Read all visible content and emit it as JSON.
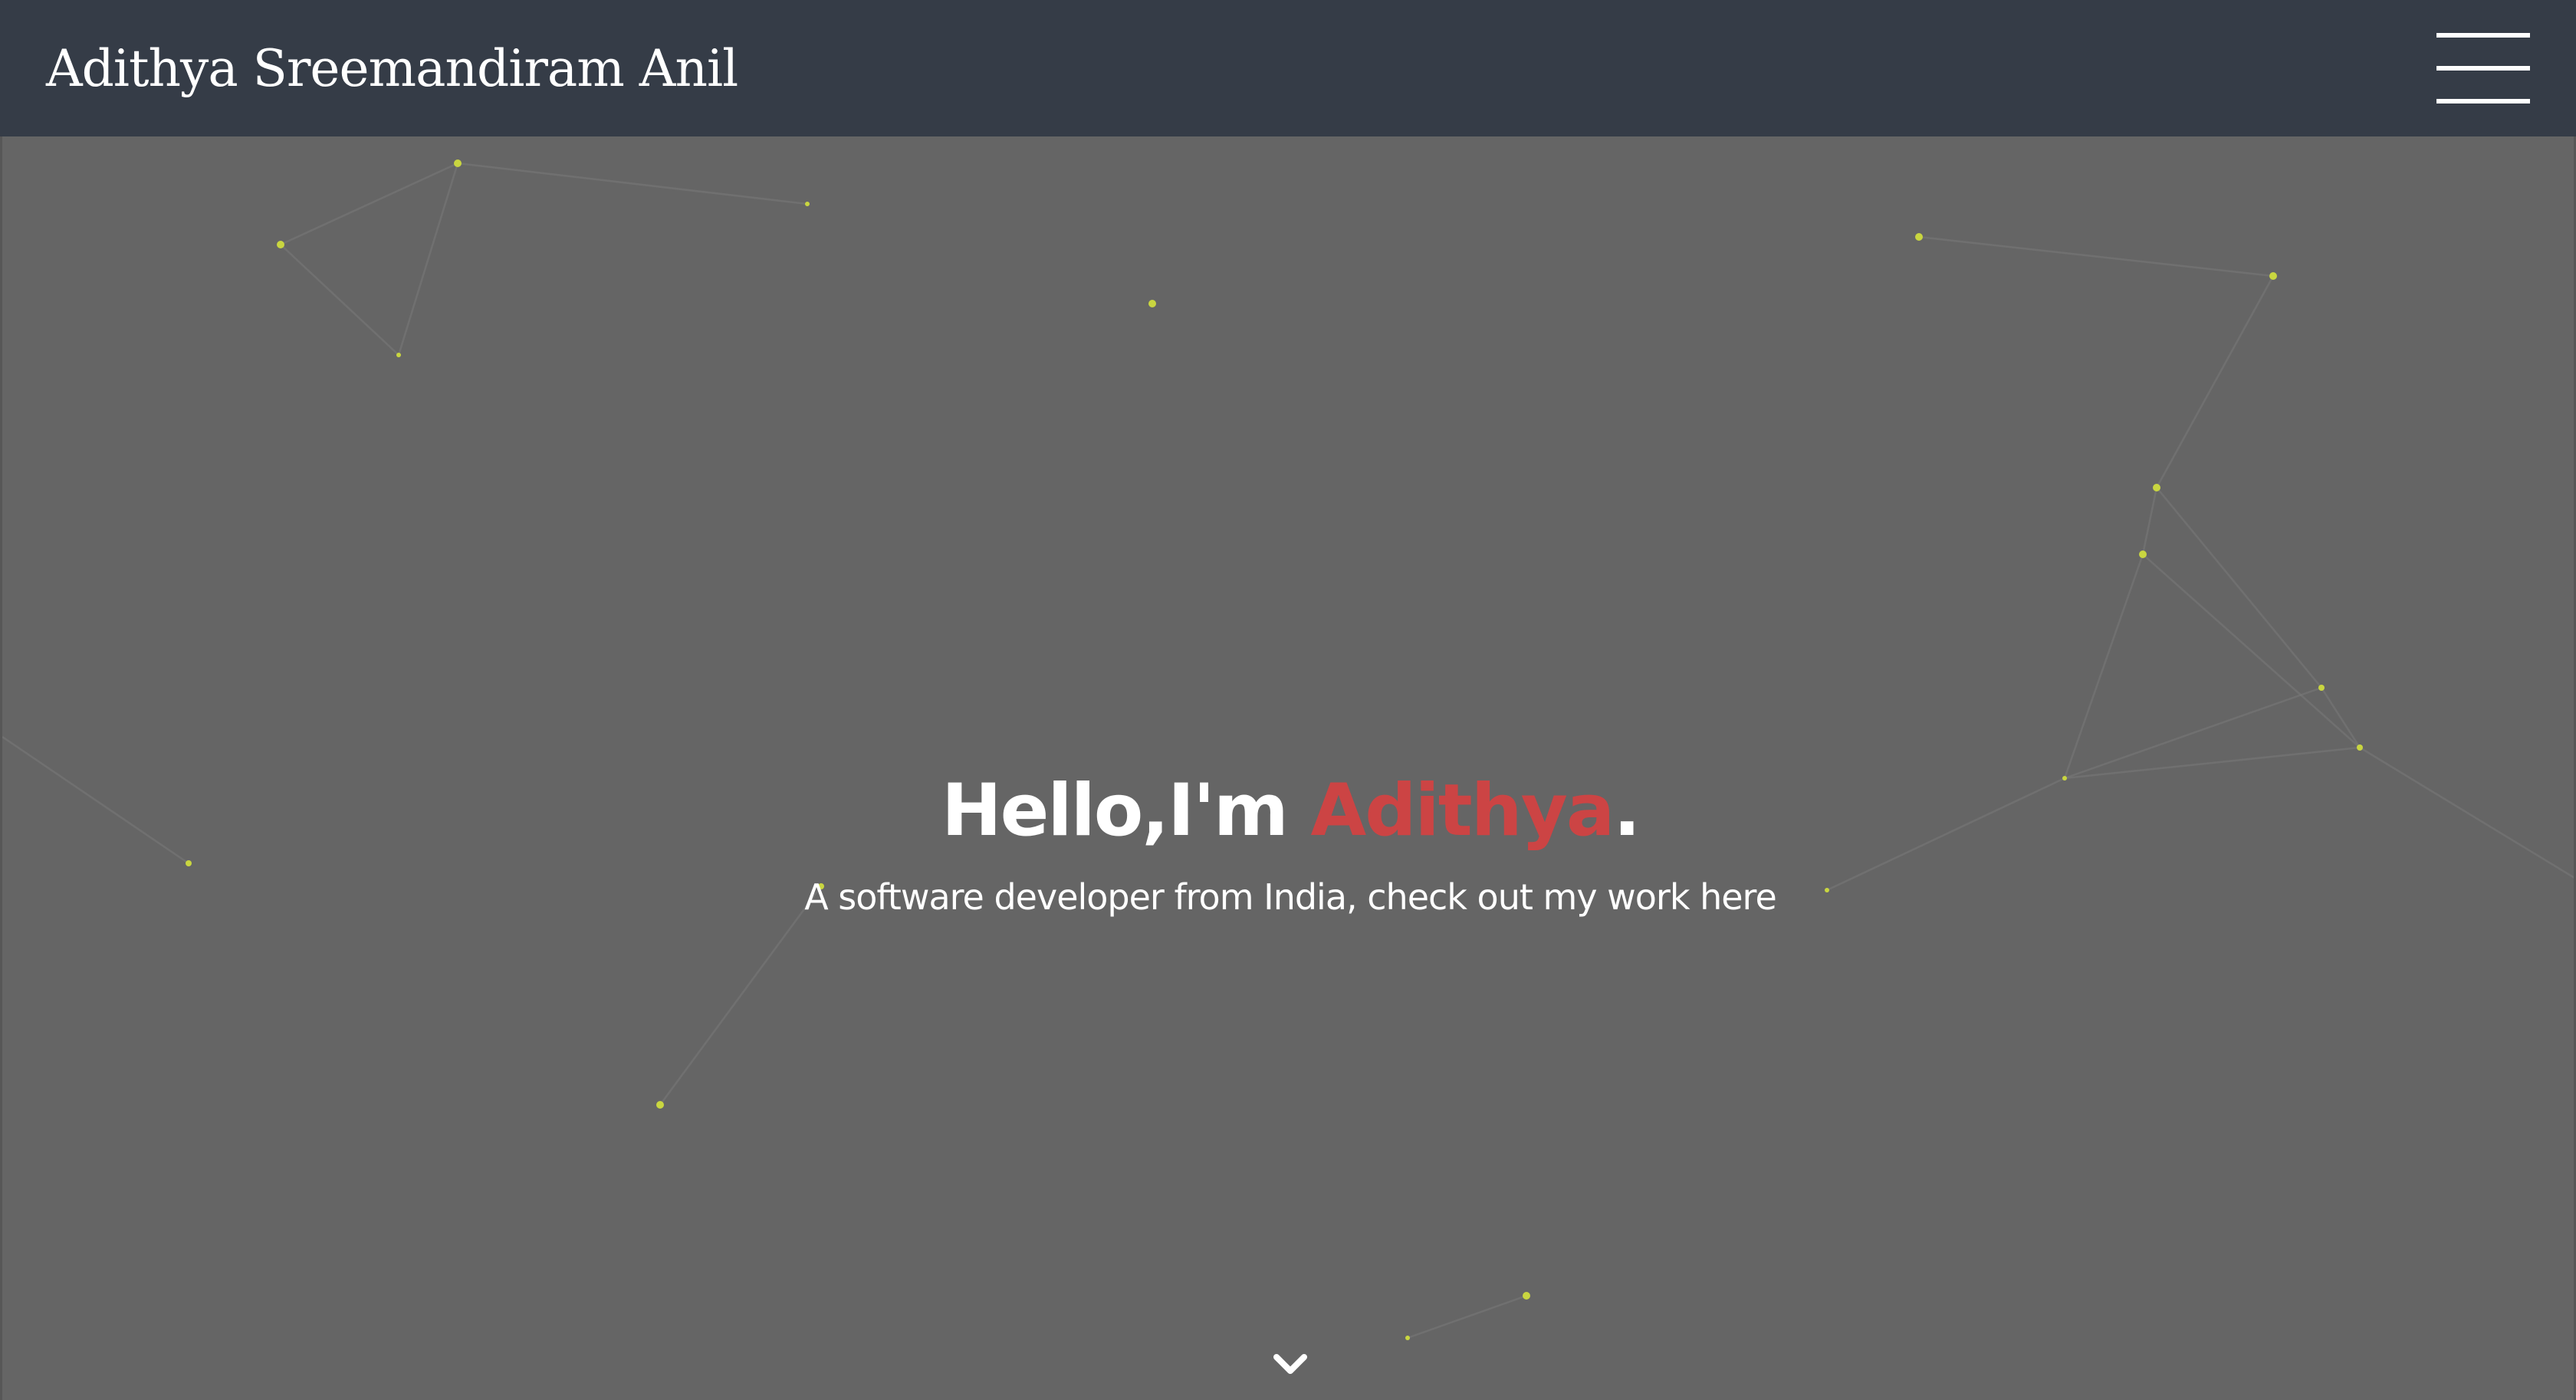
{
  "header": {
    "brand": "Adithya Sreemandiram Anil",
    "menu_icon": "hamburger-menu-icon"
  },
  "hero": {
    "greeting_prefix": "Hello,I'm ",
    "greeting_name": "Adithya",
    "greeting_suffix": ".",
    "subtitle": "A software developer from India, check out my work here",
    "scroll_icon": "chevron-down-icon"
  },
  "colors": {
    "navbar": "#353c47",
    "hero_background": "#656565",
    "accent": "#cc4444",
    "particle": "#c9d640"
  }
}
